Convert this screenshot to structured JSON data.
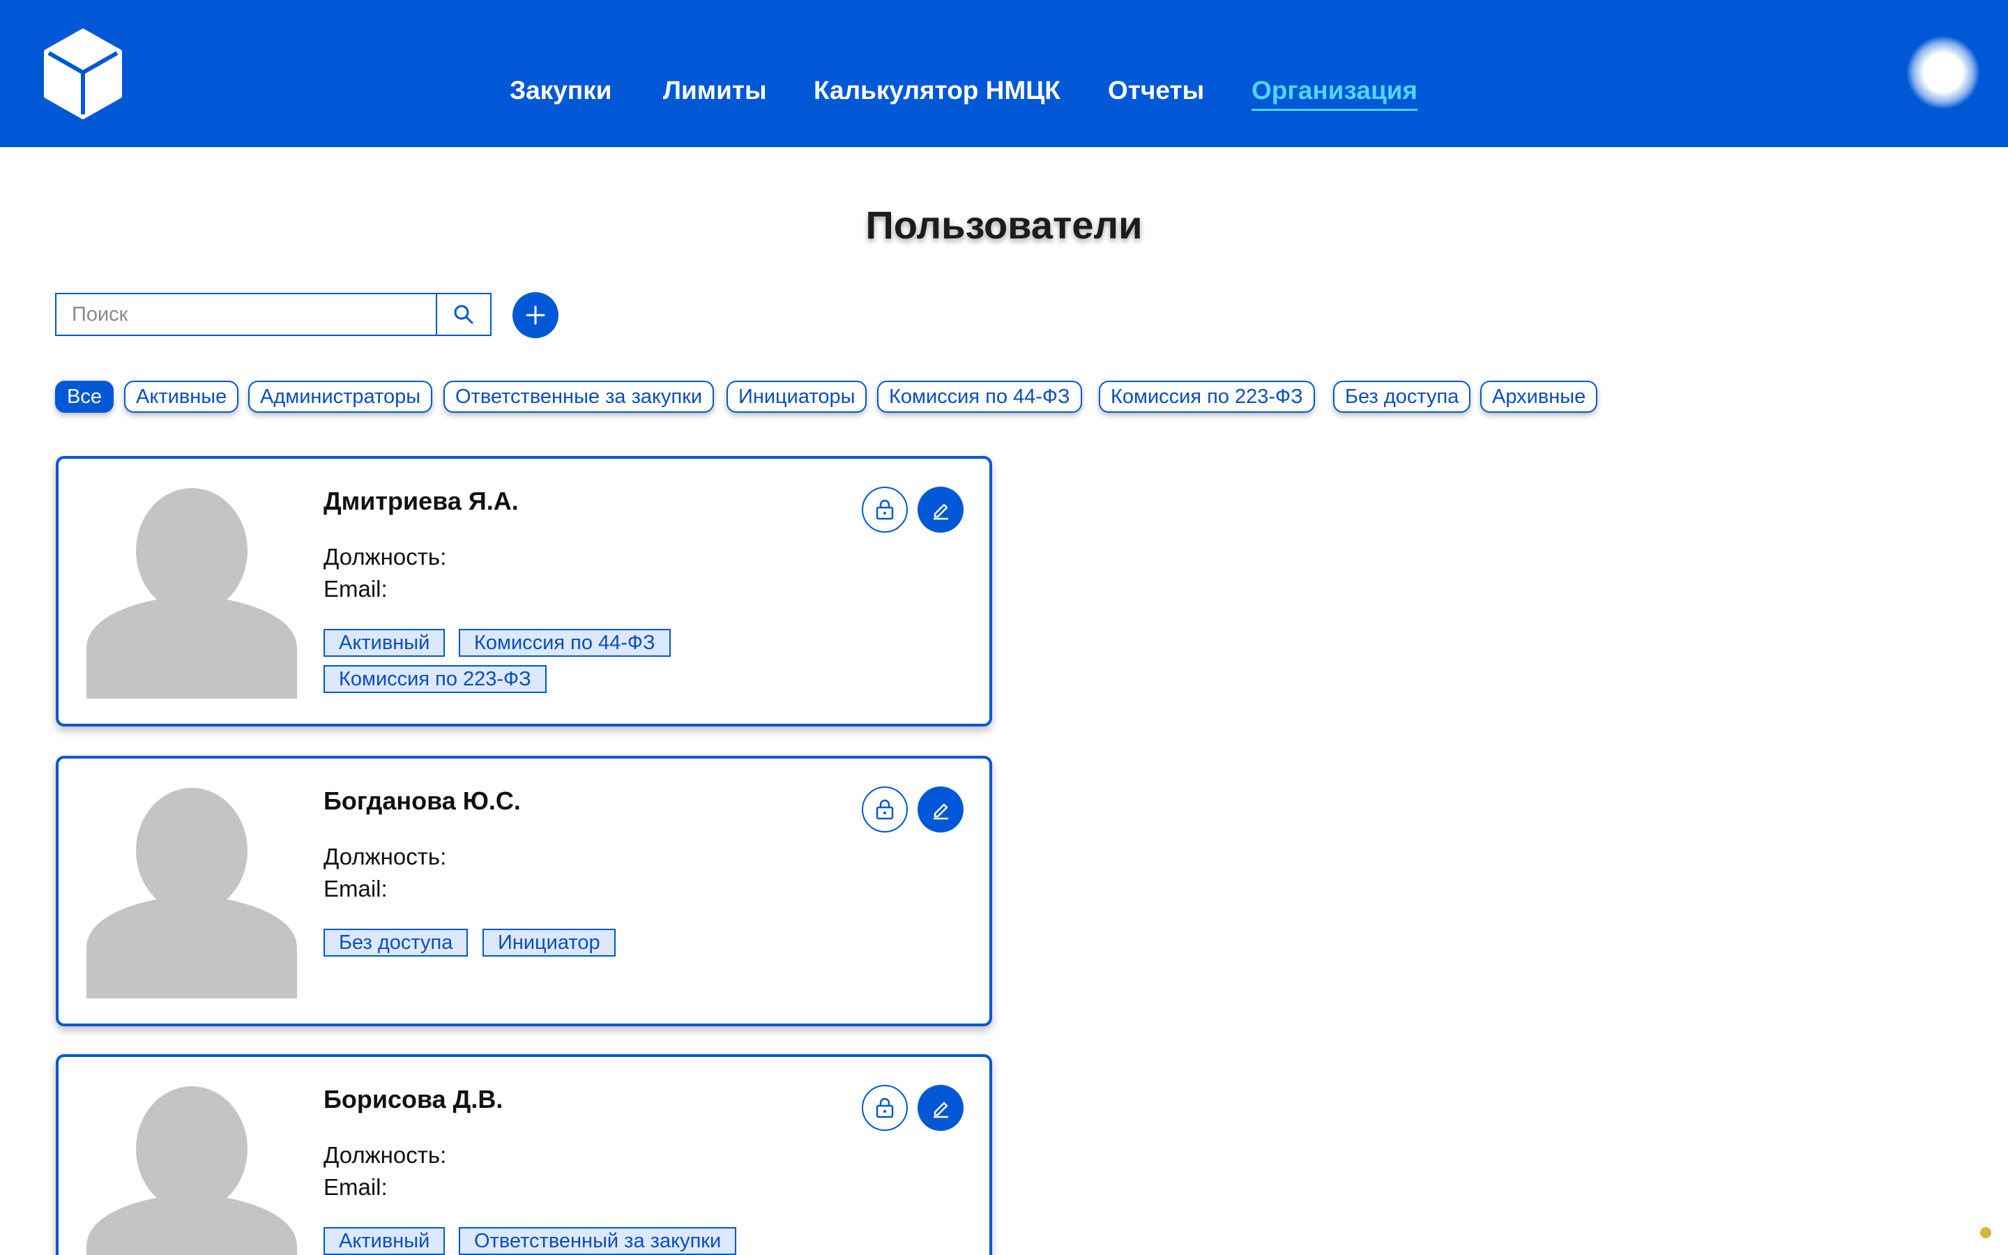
{
  "nav": {
    "items": [
      {
        "label": "Закупки"
      },
      {
        "label": "Лимиты"
      },
      {
        "label": "Калькулятор НМЦК"
      },
      {
        "label": "Отчеты"
      },
      {
        "label": "Организация",
        "active": true
      }
    ]
  },
  "page": {
    "title": "Пользователи"
  },
  "search": {
    "placeholder": "Поиск",
    "value": ""
  },
  "filters": [
    {
      "label": "Все",
      "active": true
    },
    {
      "label": "Активные"
    },
    {
      "label": "Администраторы"
    },
    {
      "label": "Ответственные за закупки"
    },
    {
      "label": "Инициаторы"
    },
    {
      "label": "Комиссия по 44-ФЗ"
    },
    {
      "label": "Комиссия по 223-ФЗ"
    },
    {
      "label": "Без доступа"
    },
    {
      "label": "Архивные"
    }
  ],
  "users": [
    {
      "name": "Дмитриева Я.А.",
      "position_label": "Должность:",
      "email_label": "Email:",
      "tags": [
        "Активный",
        "Комиссия по 44-ФЗ",
        "Комиссия по 223-ФЗ"
      ]
    },
    {
      "name": "Богданова Ю.С.",
      "position_label": "Должность:",
      "email_label": "Email:",
      "tags": [
        "Без доступа",
        "Инициатор"
      ]
    },
    {
      "name": "Борисова Д.В.",
      "position_label": "Должность:",
      "email_label": "Email:",
      "tags": [
        "Активный",
        "Ответственный за закупки"
      ]
    }
  ],
  "colors": {
    "brand": "#0058d6",
    "active_nav": "#4fd6ff",
    "tag_bg": "#dce8fb",
    "avatar_placeholder": "#c4c4c4"
  },
  "icons": {
    "logo": "cube-logo-icon",
    "search": "search-icon",
    "add": "plus-icon",
    "lock": "lock-icon",
    "edit": "pencil-icon",
    "avatar": "user-silhouette-icon"
  }
}
